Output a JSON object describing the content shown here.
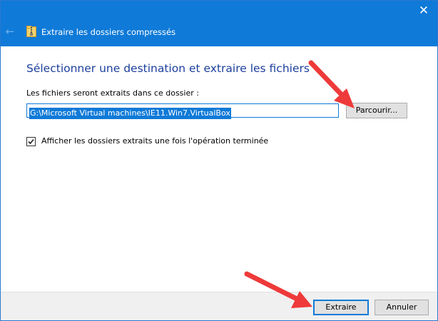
{
  "window": {
    "title": "Extraire les dossiers compressés",
    "close_glyph": "✕",
    "back_glyph": "←",
    "title_icon": "zip-folder-icon"
  },
  "main": {
    "heading": "Sélectionner une destination et extraire les fichiers",
    "field_label": "Les fichiers seront extraits dans ce dossier :",
    "path_value": "G:\\Microsoft Virtual machines\\IE11.Win7.VirtualBox",
    "browse_label": "Parcourir...",
    "show_folders_label": "Afficher les dossiers extraits une fois l'opération terminée",
    "show_folders_checked": true
  },
  "footer": {
    "extract_label": "Extraire",
    "cancel_label": "Annuler"
  },
  "colors": {
    "accent": "#0f7ad8",
    "heading": "#1c3f9e",
    "arrow": "#ee3a3a"
  }
}
